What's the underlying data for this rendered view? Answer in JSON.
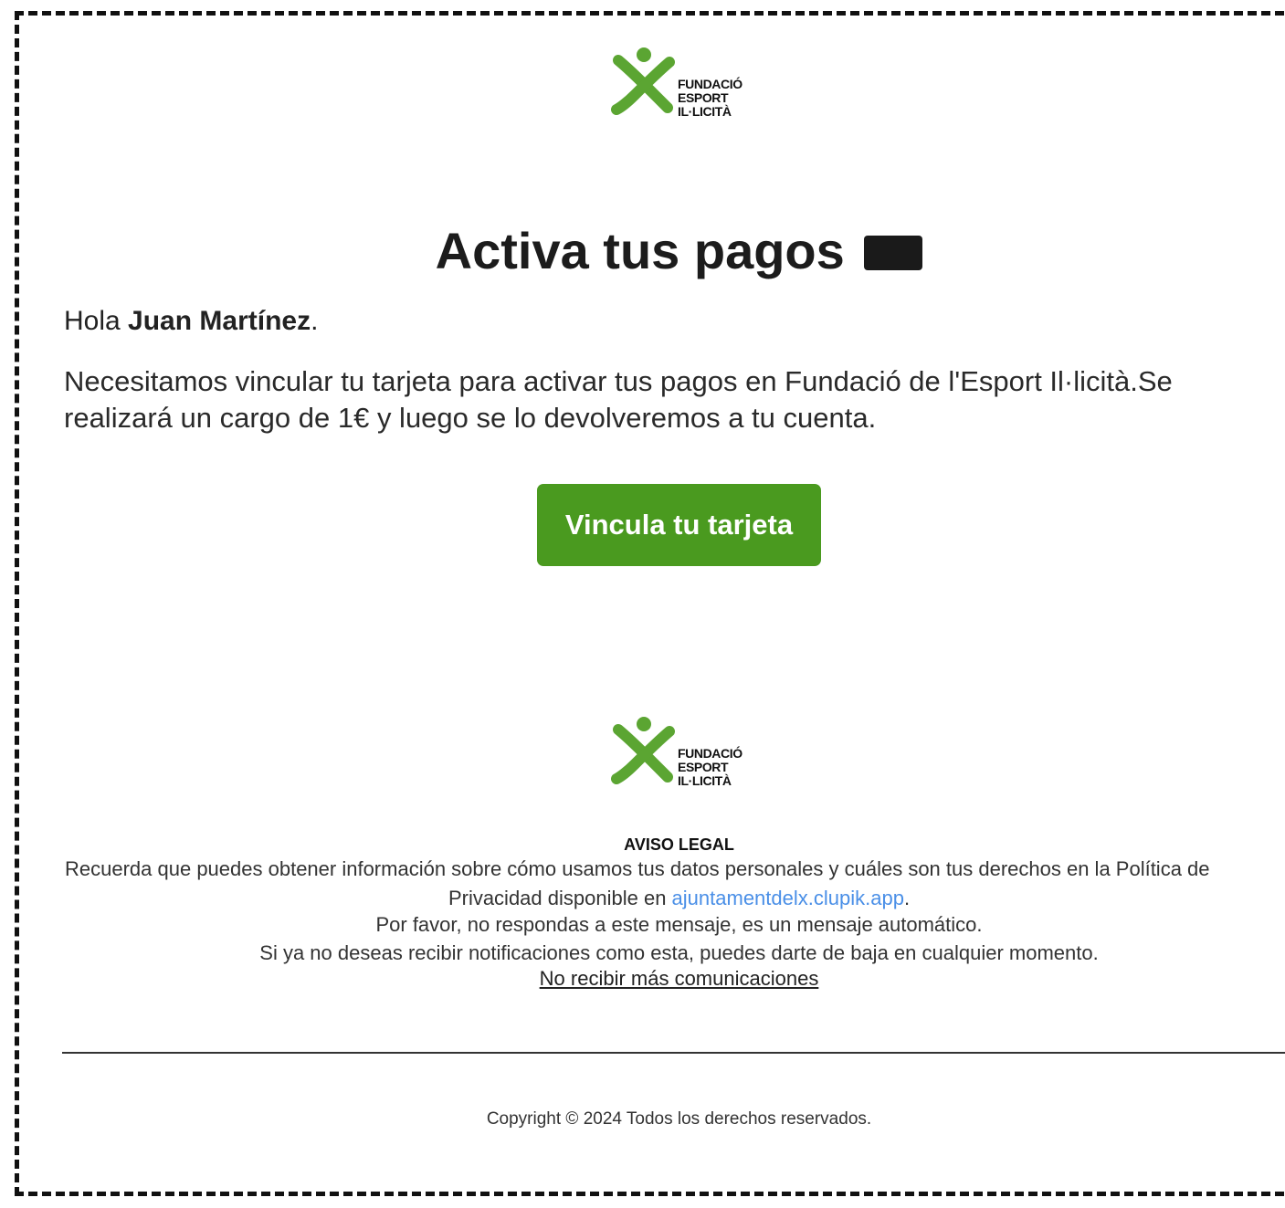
{
  "colors": {
    "brand_green": "#4a9a1f",
    "logo_green": "#5ba532",
    "link_blue": "#4a8fe7",
    "text_dark": "#222222"
  },
  "logo": {
    "icon": "fundacio-person-icon",
    "lines": [
      "FUNDACIÓ",
      "ESPORT",
      "IL·LICITÀ"
    ]
  },
  "header": {
    "title": "Activa tus pagos"
  },
  "greeting": {
    "prefix": "Hola ",
    "name": "Juan Martínez",
    "suffix": "."
  },
  "message": {
    "text": "Necesitamos vincular tu tarjeta para activar tus pagos en Fundació de l'Esport Il·licità.Se realizará un cargo de 1€ y luego se lo devolveremos a tu cuenta."
  },
  "cta": {
    "label": "Vincula tu tarjeta"
  },
  "footer": {
    "legal_title": "AVISO LEGAL",
    "legal_line1": "Recuerda que puedes obtener información sobre cómo usamos tus datos personales y cuáles son tus derechos en la Política de",
    "legal_line2_prefix": "Privacidad disponible en ",
    "legal_link": "ajuntamentdelx.clupik.app",
    "legal_line2_suffix": ".",
    "legal_line3": "Por favor, no respondas a este mensaje, es un mensaje automático.",
    "legal_line4": "Si ya no deseas recibir notificaciones como esta, puedes darte de baja en cualquier momento.",
    "unsubscribe_label": "No recibir más comunicaciones",
    "copyright": "Copyright © 2024 Todos los derechos reservados."
  }
}
